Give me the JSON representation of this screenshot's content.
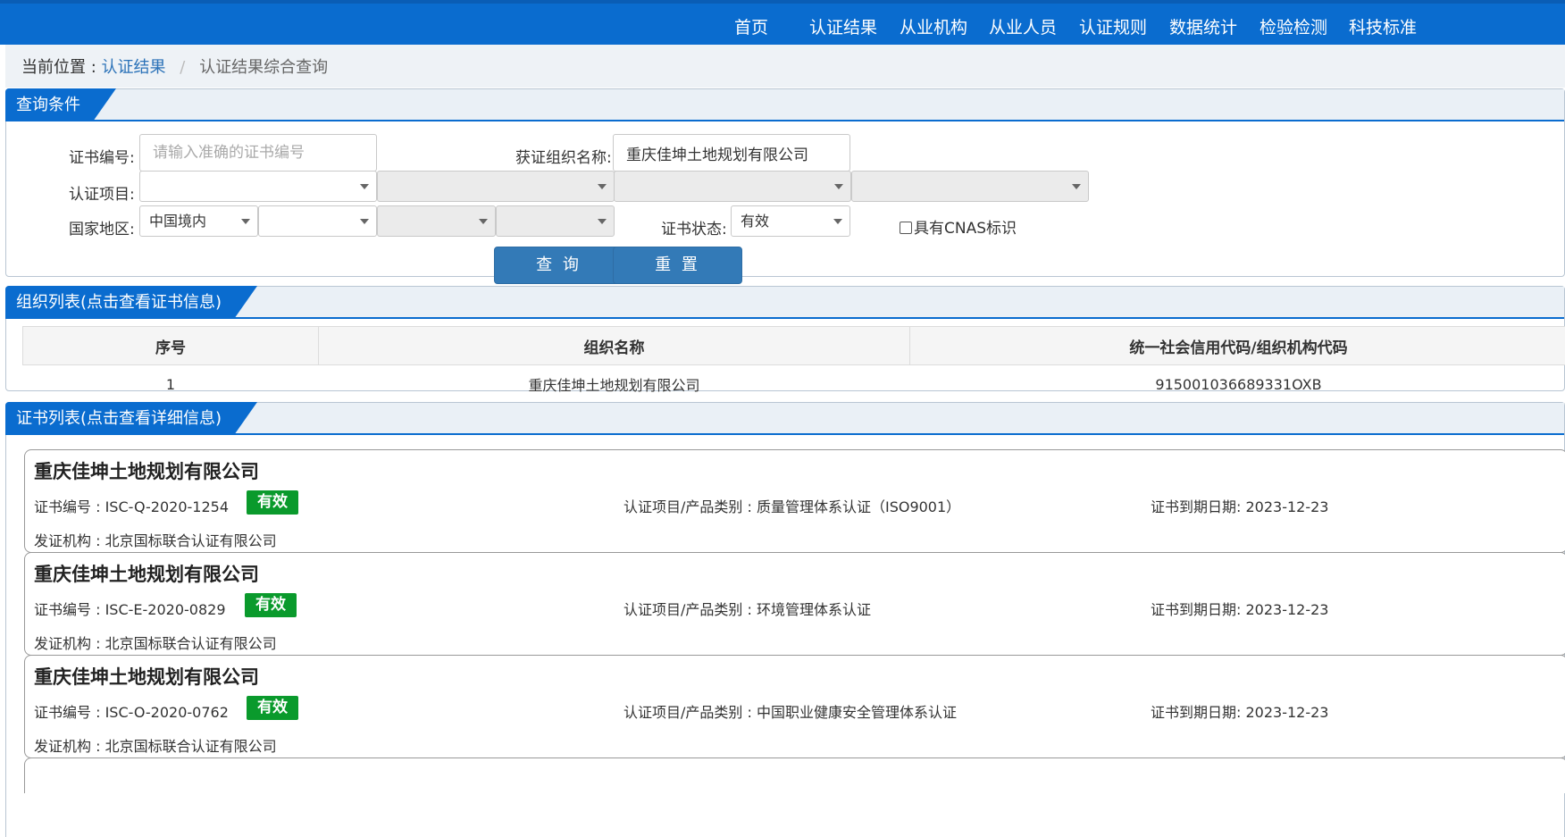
{
  "nav": {
    "items": [
      "首页",
      "认证结果",
      "从业机构",
      "从业人员",
      "认证规则",
      "数据统计",
      "检验检测",
      "科技标准"
    ]
  },
  "breadcrumb": {
    "prefix": "当前位置 :",
    "link": "认证结果",
    "separator": "/",
    "current": "认证结果综合查询"
  },
  "query": {
    "title": "查询条件",
    "cert_no_label": "证书编号:",
    "cert_no_placeholder": "请输入准确的证书编号",
    "org_name_label": "获证组织名称:",
    "org_name_value": "重庆佳坤土地规划有限公司",
    "project_label": "认证项目:",
    "region_label": "国家地区:",
    "region_value": "中国境内",
    "status_label": "证书状态:",
    "status_value": "有效",
    "cnas_label": "具有CNAS标识",
    "search_button": "查 询",
    "reset_button": "重 置"
  },
  "org_list": {
    "title": "组织列表(点击查看证书信息)",
    "headers": [
      "序号",
      "组织名称",
      "统一社会信用代码/组织机构代码"
    ],
    "rows": [
      [
        "1",
        "重庆佳坤土地规划有限公司",
        "915001036689331OXB"
      ]
    ]
  },
  "cert_list": {
    "title": "证书列表(点击查看详细信息)",
    "cert_no_prefix": "证书编号 :",
    "project_prefix": "认证项目/产品类别 :",
    "expire_prefix": "证书到期日期:",
    "issuer_prefix": "发证机构 :",
    "cards": [
      {
        "org": "重庆佳坤土地规划有限公司",
        "cert_no": "ISC-Q-2020-1254",
        "status": "有效",
        "project": "质量管理体系认证（ISO9001）",
        "expire": "2023-12-23",
        "issuer": "北京国标联合认证有限公司"
      },
      {
        "org": "重庆佳坤土地规划有限公司",
        "cert_no": "ISC-E-2020-0829",
        "status": "有效",
        "project": "环境管理体系认证",
        "expire": "2023-12-23",
        "issuer": "北京国标联合认证有限公司"
      },
      {
        "org": "重庆佳坤土地规划有限公司",
        "cert_no": "ISC-O-2020-0762",
        "status": "有效",
        "project": "中国职业健康安全管理体系认证",
        "expire": "2023-12-23",
        "issuer": "北京国标联合认证有限公司"
      }
    ]
  },
  "colors": {
    "primary": "#0a6ccf",
    "button": "#337ab7",
    "badge": "#0a9a2c"
  }
}
